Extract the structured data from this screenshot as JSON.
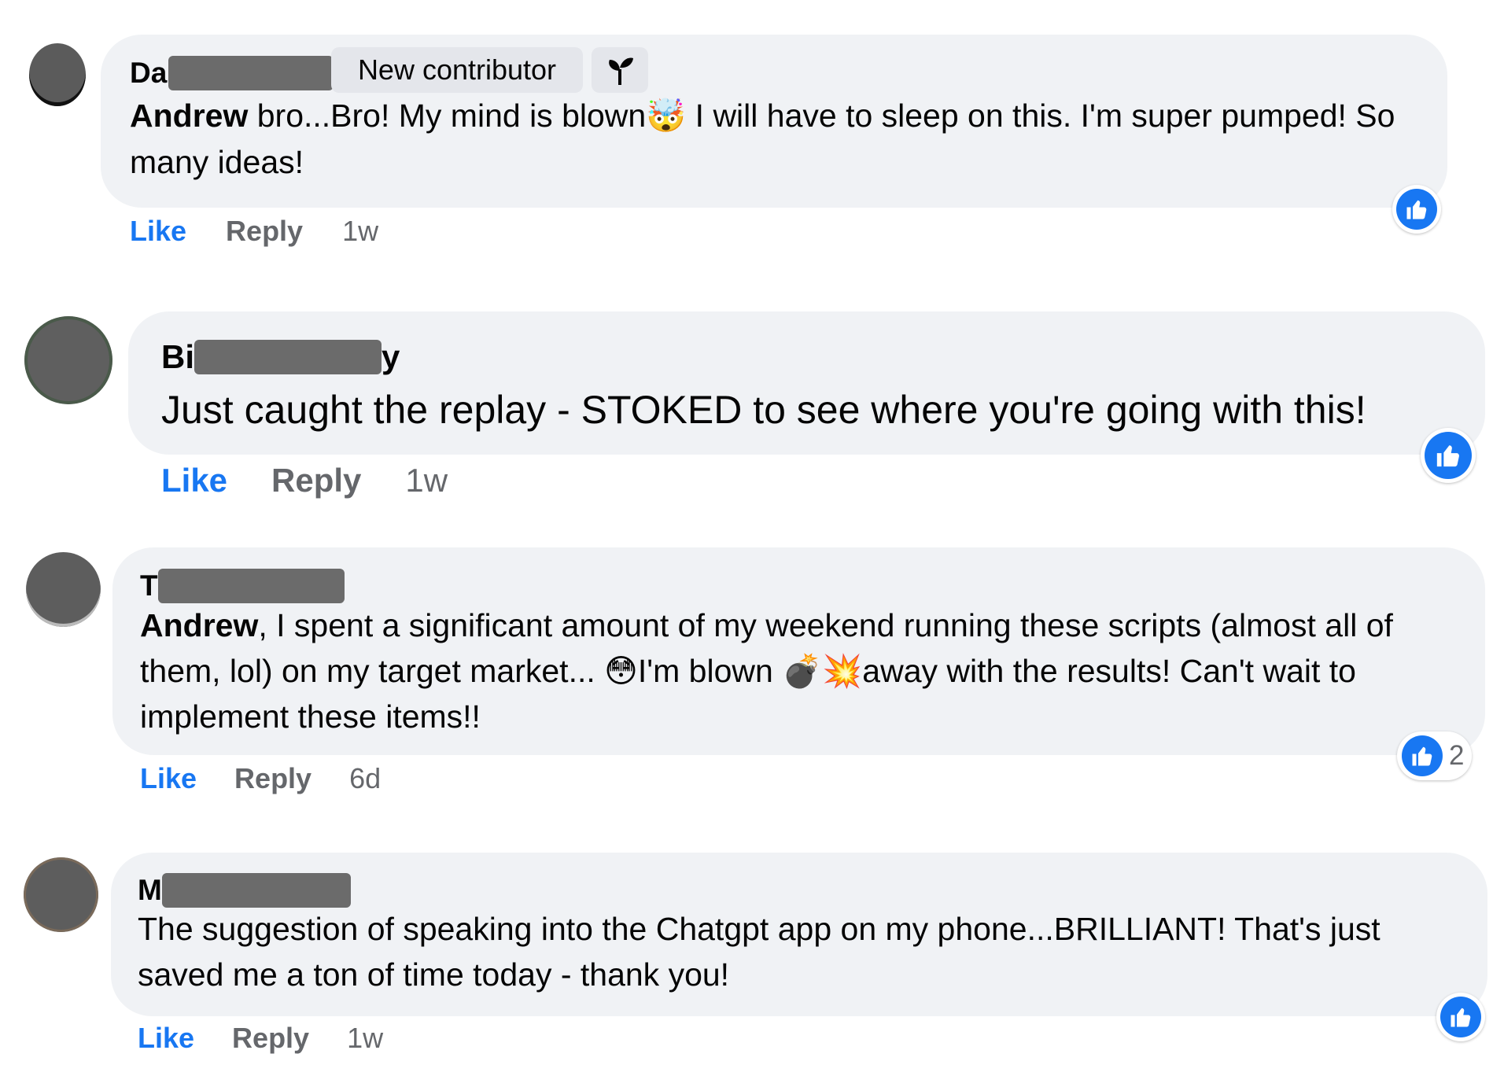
{
  "colors": {
    "bubble": "#f0f2f5",
    "like_blue": "#1877f2",
    "secondary_text": "#65676b",
    "redaction": "#6b6b6b"
  },
  "comments": [
    {
      "author_visible": "Da",
      "badge": "New contributor",
      "badge_icon": "sprout-icon",
      "mention": "Andrew",
      "body_part1": " bro...Bro! My mind is blown",
      "emoji1": "🤯",
      "body_part2": " I will have to sleep on this. I'm super pumped! So many ideas!",
      "like_label": "Like",
      "reply_label": "Reply",
      "time": "1w",
      "reaction_icon": "thumbs-up-icon"
    },
    {
      "author_visible_start": "Bi",
      "author_visible_end": "y",
      "body": "Just caught the replay - STOKED to see where you're going with this!",
      "like_label": "Like",
      "reply_label": "Reply",
      "time": "1w",
      "reaction_icon": "thumbs-up-icon"
    },
    {
      "author_visible": "T",
      "mention": "Andrew",
      "body_part1": ", I spent a significant amount of my weekend running these scripts (almost all of them, lol) on my target market... ",
      "emoji1": "😳",
      "body_part2": "I'm blown ",
      "emoji2": "💣",
      "emoji3": "💥",
      "body_part3": "away with the results! Can't wait to implement these items!!",
      "like_label": "Like",
      "reply_label": "Reply",
      "time": "6d",
      "reaction_icon": "thumbs-up-icon",
      "reaction_count": "2"
    },
    {
      "author_visible": "M",
      "body": "The suggestion of speaking into the Chatgpt app on my phone...BRILLIANT! That's just saved me a ton of time today - thank you!",
      "like_label": "Like",
      "reply_label": "Reply",
      "time": "1w",
      "reaction_icon": "thumbs-up-icon"
    }
  ]
}
